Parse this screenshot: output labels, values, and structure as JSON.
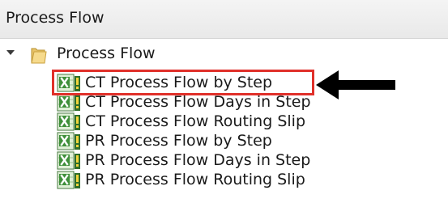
{
  "panel": {
    "title": "Process Flow"
  },
  "tree": {
    "folder": {
      "label": "Process Flow",
      "icon": "folder-icon",
      "expanded": true
    },
    "items": [
      {
        "label": "CT Process Flow by Step",
        "icon": "excel-report-icon",
        "highlighted": true
      },
      {
        "label": "CT Process Flow Days in Step",
        "icon": "excel-report-icon"
      },
      {
        "label": "CT Process Flow Routing Slip",
        "icon": "excel-report-icon"
      },
      {
        "label": "PR Process Flow by Step",
        "icon": "excel-report-icon"
      },
      {
        "label": "PR Process Flow Days in Step",
        "icon": "excel-report-icon"
      },
      {
        "label": "PR Process Flow Routing Slip",
        "icon": "excel-report-icon"
      }
    ]
  },
  "colors": {
    "highlight": "#e0302a",
    "arrow": "#000000",
    "header_bg": "#efefef"
  }
}
